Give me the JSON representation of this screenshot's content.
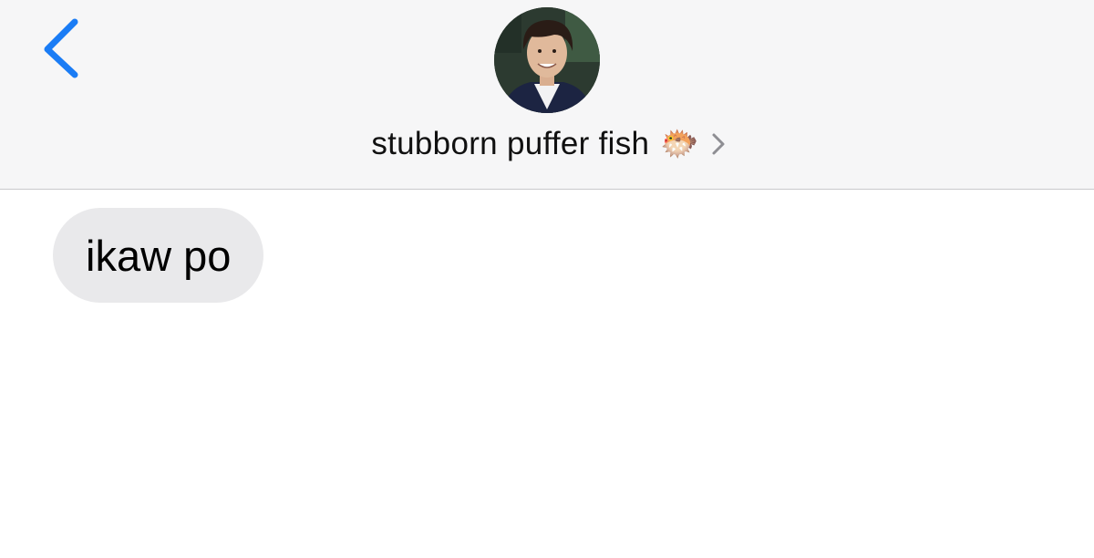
{
  "header": {
    "back_icon": "chevron-left-icon",
    "avatar_icon": "contact-photo",
    "contact_name": "stubborn puffer fish",
    "contact_emoji": "🐡",
    "chevron_icon": "chevron-right-icon"
  },
  "messages": [
    {
      "direction": "incoming",
      "text": "ikaw po"
    }
  ],
  "colors": {
    "accent": "#1a7cf5",
    "header_bg": "#f6f6f7",
    "incoming_bubble": "#e9e9eb",
    "chevron_gray": "#8e8e93"
  }
}
